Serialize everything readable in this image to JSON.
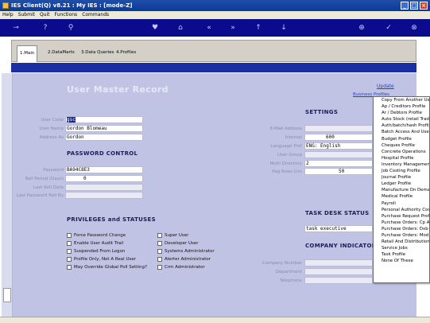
{
  "window": {
    "title": "IES Client(Q) v8.21 : My IES :     [mode-Z]"
  },
  "menu": [
    "Help",
    "Submit",
    "Quit",
    "Functions",
    "Commands"
  ],
  "tabs": [
    {
      "label": "1.Main",
      "active": true
    },
    {
      "label": "2.DataMarts"
    },
    {
      "label": "3.Data Queries"
    },
    {
      "label": "4.Profiles"
    }
  ],
  "page": {
    "title": "User Master Record"
  },
  "user": {
    "user_code_label": "User Code",
    "user_code": "gsc",
    "user_name_label": "User Name",
    "user_name": "Gordon Blomeau",
    "address_as_label": "Address As",
    "address_as": "Gordon"
  },
  "password": {
    "section_title": "PASSWORD CONTROL",
    "password_label": "Password",
    "password": "BA94C8E3",
    "roll_period_label": "Roll Period (Days)",
    "roll_period": "0",
    "last_roll_date_label": "Last Roll Date",
    "last_roll_by_label": "Last Password Roll By"
  },
  "privileges": {
    "section_title": "PRIVILEGES and STATUSES",
    "col1": [
      "Force Password Change",
      "Enable User Audit Trail",
      "Suspended From Logon",
      "Profile Only, Not A Real User",
      "May Override Global Poll Setting?"
    ],
    "col2": [
      "Super User",
      "Developer User",
      "Systems Administrator",
      "Alerter Administrator",
      "Crm Administrator"
    ]
  },
  "settings": {
    "section_title": "SETTINGS",
    "email_label": "E-Mail Address",
    "internal_label": "Internal",
    "internal": "600",
    "language_label": "Language Pref",
    "language": "ENG: English",
    "user_group_label": "User Group",
    "multi_directory_label": "Multi Directory",
    "multi_directory": "2",
    "pag_rows_label": "Pag Rows Lim",
    "pag_rows": "50"
  },
  "task_desk": {
    "section_title": "TASK DESK STATUS",
    "value": "task executive"
  },
  "company": {
    "section_title": "COMPANY INDICATORS",
    "company_number_label": "Company Number",
    "department_label": "Department",
    "telephone_label": "Telephone"
  },
  "links": {
    "update": "Update",
    "business_profiles": "Business Profiles"
  },
  "dropdown_items": [
    "Copy From Another User",
    "Ap / Creditors Profile",
    "Ar / Debtors Profile",
    "Auto Stock (retail Trade",
    "Auth/batch/hash Profile",
    "Batch Access And User",
    "Budget Profile",
    "Cheques Profile",
    "Concrete Operations",
    "Hospital Profile",
    "Inventory Management",
    "Job Costing Profile",
    "Journal Profile",
    "Ledger Profile",
    "Manufacture On Demand",
    "Medical Profile",
    "Payroll",
    "Personal Authority Code",
    "Purchase Request Profile",
    "Purchase Orders: Cp And",
    "Purchase Orders: Dxb P",
    "Purchase Orders: Mod P",
    "Retail And Distribution",
    "Service Jobs",
    "Task Profile",
    "None Of These"
  ]
}
